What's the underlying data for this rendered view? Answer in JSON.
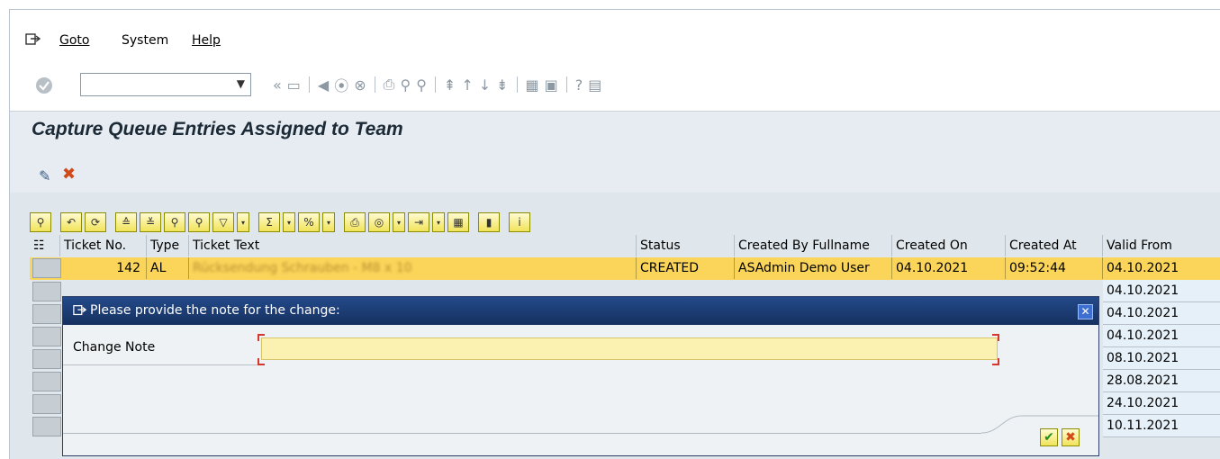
{
  "menu": {
    "items": [
      "Goto",
      "System",
      "Help"
    ]
  },
  "toolbar": {
    "command_field_value": ""
  },
  "screen_title": "Capture Queue Entries Assigned to Team",
  "grid": {
    "columns": [
      "Ticket No.",
      "Type",
      "Ticket Text",
      "Status",
      "Created By Fullname",
      "Created On",
      "Created At",
      "Valid From"
    ],
    "selected_row": {
      "ticket_no": "142",
      "type": "AL",
      "ticket_text": "Rücksendung Schrauben - M8 x 10",
      "status": "CREATED",
      "created_by": "ASAdmin Demo User",
      "created_on": "04.10.2021",
      "created_at": "09:52:44",
      "valid_from": "04.10.2021"
    },
    "valid_from_values": [
      "04.10.2021",
      "04.10.2021",
      "04.10.2021",
      "08.10.2021",
      "28.08.2021",
      "24.10.2021",
      "10.11.2021"
    ]
  },
  "dialog": {
    "title": "Please provide the note for the change:",
    "field_label": "Change Note",
    "field_value": "",
    "close_label": "✕",
    "ok_label": "✔",
    "cancel_label": "✖"
  }
}
